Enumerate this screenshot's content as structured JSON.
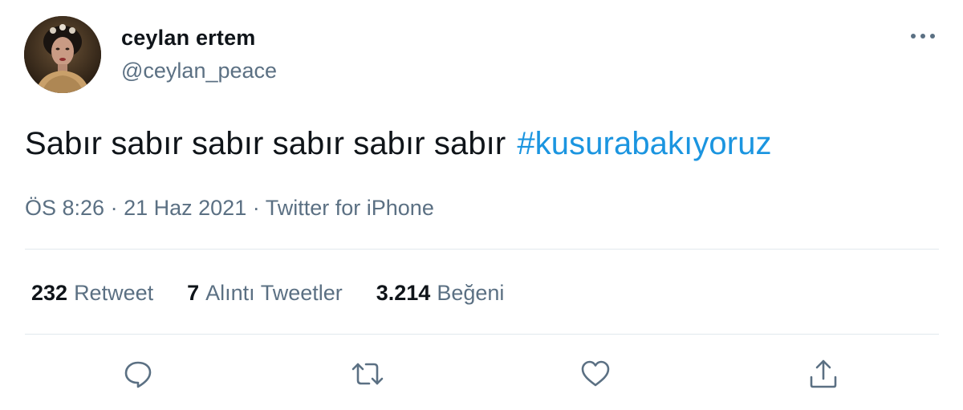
{
  "author": {
    "display_name": "ceylan ertem",
    "handle": "@ceylan_peace"
  },
  "tweet": {
    "text": "Sabır sabır sabır sabır sabır sabır",
    "hashtag": "#kusurabakıyoruz"
  },
  "meta": {
    "time": "ÖS 8:26",
    "separator": "·",
    "date": "21 Haz 2021",
    "source": "Twitter for iPhone"
  },
  "stats": {
    "retweets": {
      "count": "232",
      "label": "Retweet"
    },
    "quotes": {
      "count": "7",
      "label": "Alıntı Tweetler"
    },
    "likes": {
      "count": "3.214",
      "label": "Beğeni"
    }
  },
  "colors": {
    "hashtag": "#1b95e0",
    "secondary_text": "#5b7083",
    "primary_text": "#0f1419",
    "divider": "#e1e8ed"
  },
  "icons": {
    "more": "more-horizontal-icon",
    "reply": "reply-icon",
    "retweet": "retweet-icon",
    "like": "heart-icon",
    "share": "share-icon"
  }
}
